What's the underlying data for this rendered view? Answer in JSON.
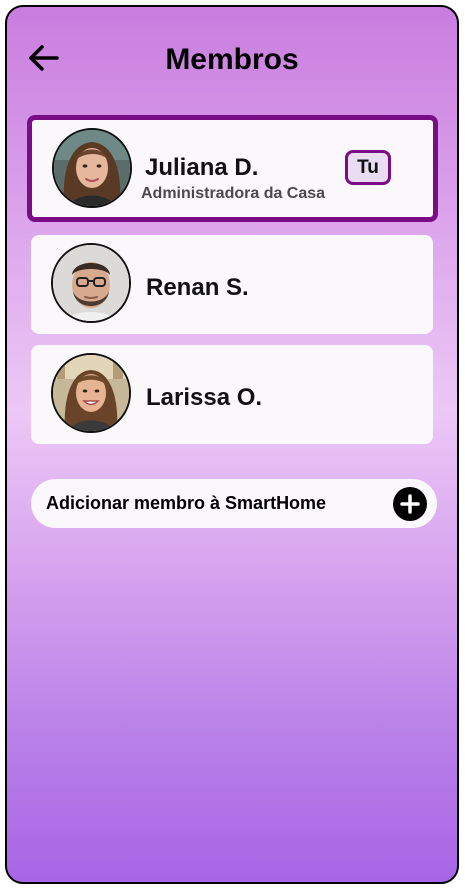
{
  "header": {
    "title": "Membros",
    "back_icon": "arrow-left-icon"
  },
  "members": [
    {
      "name": "Juliana D.",
      "role": "Administradora da Casa",
      "badge": "Tu",
      "current_user": true
    },
    {
      "name": "Renan S.",
      "role": "",
      "badge": "",
      "current_user": false
    },
    {
      "name": "Larissa O.",
      "role": "",
      "badge": "",
      "current_user": false
    }
  ],
  "add_member": {
    "label": "Adicionar membro à SmartHome",
    "icon": "plus-circle-icon"
  },
  "colors": {
    "accent": "#7a0c86",
    "gradient_top": "#c97ddf",
    "gradient_mid": "#ecc8f6",
    "gradient_bottom": "#a865e6",
    "card": "#fbf8fc"
  }
}
